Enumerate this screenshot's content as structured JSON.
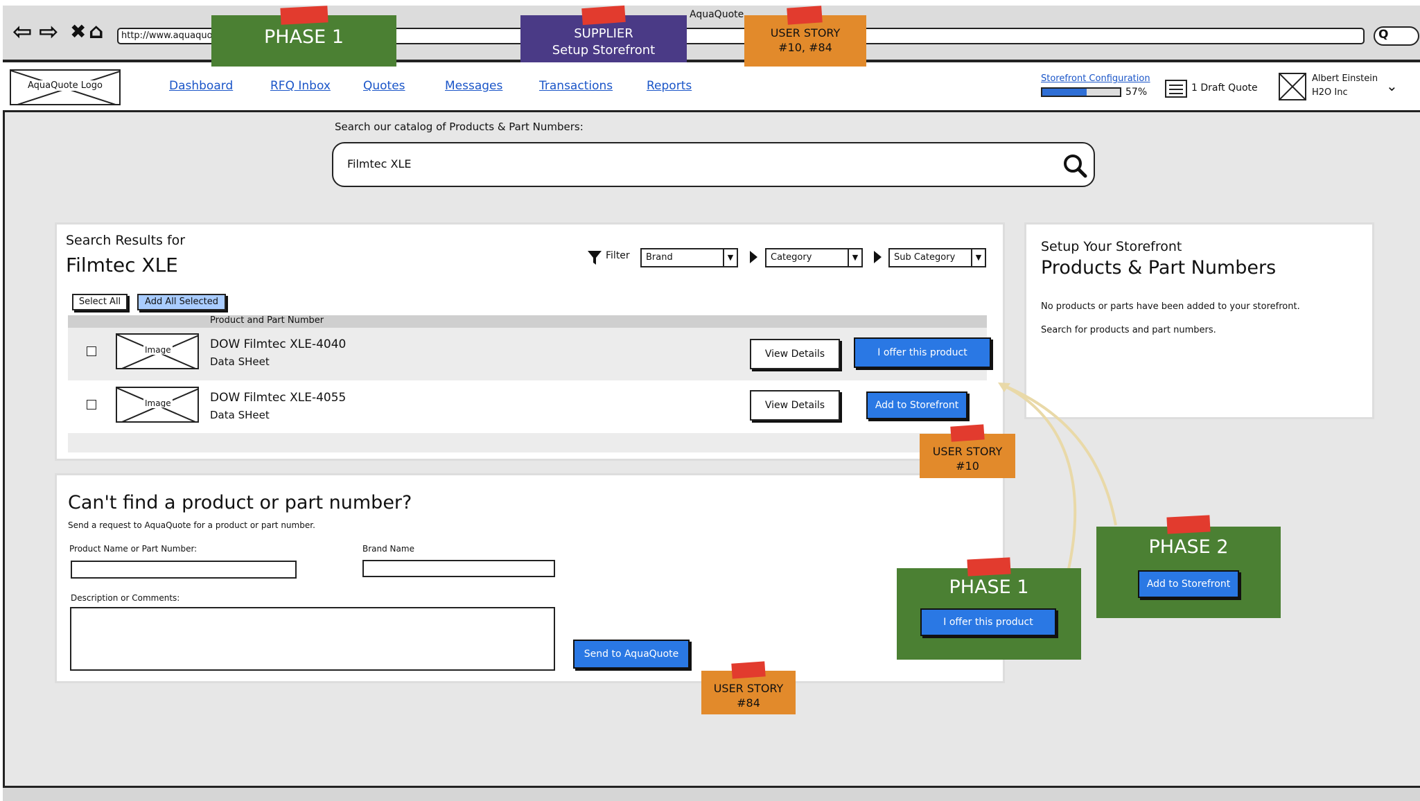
{
  "browser": {
    "window_title": "AquaQuote",
    "url": "http://www.aquaquote.com"
  },
  "header": {
    "logo_text": "AquaQuote Logo",
    "nav": [
      "Dashboard",
      "RFQ Inbox",
      "Quotes",
      "Messages",
      "Transactions",
      "Reports"
    ],
    "storefront_config": {
      "label": "Storefront Configuration",
      "progress_percent": 57,
      "progress_text": "57%"
    },
    "draft_quote_label": "1 Draft Quote",
    "user": {
      "name": "Albert Einstein",
      "org": "H2O Inc"
    }
  },
  "search": {
    "label": "Search our catalog of Products & Part Numbers:",
    "value": "Filmtec XLE"
  },
  "results": {
    "label": "Search Results for",
    "query": "Filmtec XLE",
    "filter_label": "Filter",
    "filters": [
      "Brand",
      "Category",
      "Sub Category"
    ],
    "select_all": "Select All",
    "add_all_selected": "Add All Selected",
    "column_header": "Product and Part Number",
    "rows": [
      {
        "image_label": "Image",
        "name": "DOW Filmtec XLE-4040",
        "sheet": "Data SHeet",
        "view_details": "View Details",
        "action": "I offer this product"
      },
      {
        "image_label": "Image",
        "name": "DOW Filmtec XLE-4055",
        "sheet": "Data SHeet",
        "view_details": "View Details",
        "action": "Add to Storefront"
      }
    ]
  },
  "cant_find": {
    "title": "Can't find a product or part number?",
    "subtitle": "Send a request to AquaQuote for a product or part number.",
    "product_label": "Product Name or Part Number:",
    "brand_label": "Brand Name",
    "description_label": "Description or Comments:",
    "send_button": "Send to AquaQuote"
  },
  "storefront": {
    "label": "Setup Your Storefront",
    "title": "Products & Part Numbers",
    "empty_text": "No products or parts have been added to your storefront.",
    "hint_text": "Search for products and part numbers."
  },
  "notes": {
    "phase1_top": "PHASE 1",
    "supplier_line1": "SUPPLIER",
    "supplier_line2": "Setup Storefront",
    "user_story_top_line1": "USER STORY",
    "user_story_top_line2": "#10, #84",
    "user_story_10_line1": "USER STORY",
    "user_story_10_line2": "#10",
    "user_story_84_line1": "USER STORY",
    "user_story_84_line2": "#84",
    "phase1_bottom": "PHASE 1",
    "phase1_bottom_button": "I offer this product",
    "phase2": "PHASE 2",
    "phase2_button": "Add to Storefront"
  },
  "colors": {
    "accent_blue": "#2a78e4",
    "link_blue": "#1a55c8",
    "note_green": "#4b8033",
    "note_purple": "#4a3a86",
    "note_orange": "#e28a2b",
    "tape_red": "#e23b2e"
  },
  "icons": {
    "back": "back-arrow-icon",
    "forward": "forward-arrow-icon",
    "stop": "close-icon",
    "home": "home-icon",
    "search": "search-icon",
    "filter": "filter-icon",
    "draft": "list-icon",
    "avatar": "avatar-placeholder-icon",
    "chevron": "chevron-down-icon"
  }
}
